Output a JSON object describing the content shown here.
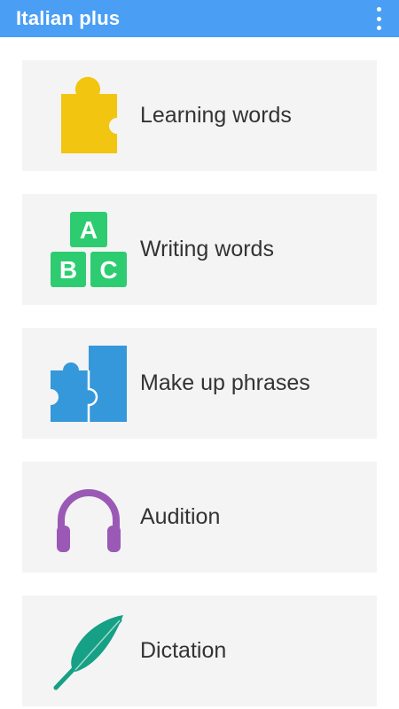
{
  "app_bar": {
    "title": "Italian plus",
    "menu_icon": "overflow-menu-icon",
    "color": "#4a9ff5"
  },
  "menu_items": [
    {
      "label": "Learning words",
      "icon": "puzzle-piece-icon",
      "icon_color": "#f2c511"
    },
    {
      "label": "Writing words",
      "icon": "abc-blocks-icon",
      "icon_color": "#2ecc71",
      "icon_letters": [
        "A",
        "B",
        "C"
      ]
    },
    {
      "label": "Make up phrases",
      "icon": "puzzle-pieces-icon",
      "icon_color": "#3498db"
    },
    {
      "label": "Audition",
      "icon": "headphones-icon",
      "icon_color": "#9b59b6"
    },
    {
      "label": "Dictation",
      "icon": "feather-icon",
      "icon_color": "#16a085"
    }
  ]
}
